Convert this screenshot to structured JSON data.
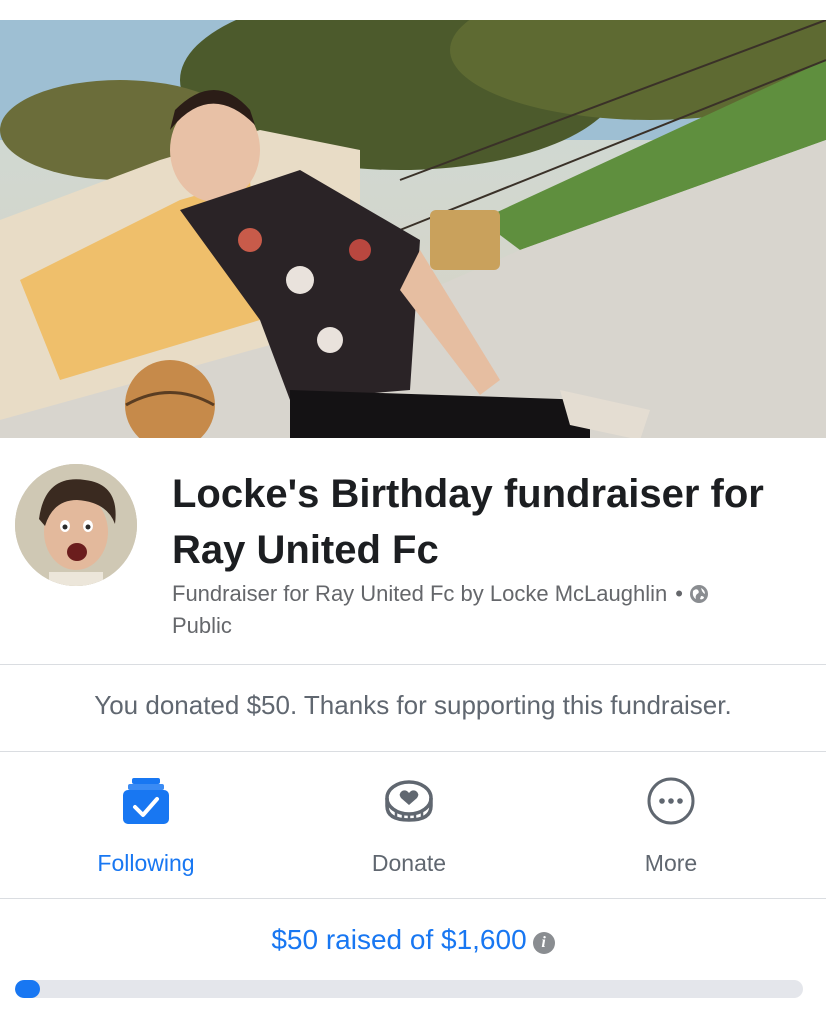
{
  "fundraiser": {
    "title": "Locke's Birthday fundraiser for Ray United Fc",
    "subtitle_text": "Fundraiser for Ray United Fc by Locke McLaughlin",
    "separator": "•",
    "privacy": "Public",
    "privacy_icon": "globe-icon"
  },
  "donation_message": "You donated $50. Thanks for supporting this fundraiser.",
  "actions": {
    "following": {
      "label": "Following",
      "icon": "following-check-icon"
    },
    "donate": {
      "label": "Donate",
      "icon": "donate-heart-coin-icon"
    },
    "more": {
      "label": "More",
      "icon": "more-dots-icon"
    }
  },
  "progress": {
    "raised_text": "$50 raised of $1,600",
    "raised": 50,
    "goal": 1600,
    "fraction": 0.03125,
    "info_icon": "info-icon"
  },
  "colors": {
    "accent": "#1877f2",
    "text_secondary": "#65676b"
  }
}
